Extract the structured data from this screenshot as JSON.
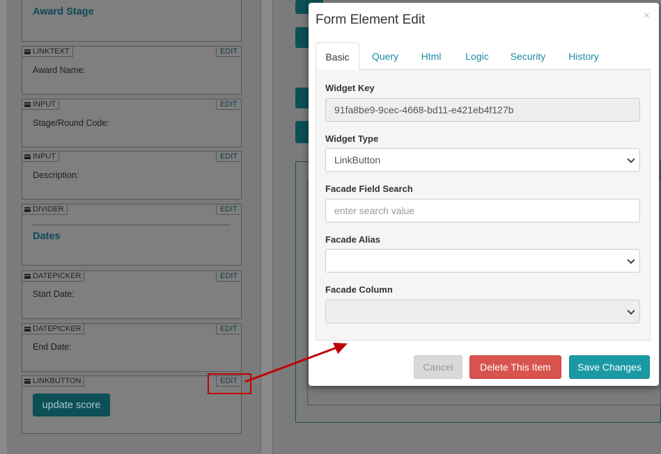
{
  "builder": {
    "widgets": [
      {
        "type": "",
        "edit": "",
        "heading": "Award Stage",
        "label": ""
      },
      {
        "type": "LINKTEXT",
        "edit": "EDIT",
        "label": "Award Name:"
      },
      {
        "type": "INPUT",
        "edit": "EDIT",
        "label": "Stage/Round Code:"
      },
      {
        "type": "INPUT",
        "edit": "EDIT",
        "label": "Description:"
      },
      {
        "type": "DIVIDER",
        "edit": "EDIT",
        "heading": "Dates"
      },
      {
        "type": "DATEPICKER",
        "edit": "EDIT",
        "label": "Start Date:"
      },
      {
        "type": "DATEPICKER",
        "edit": "EDIT",
        "label": "End Date:"
      },
      {
        "type": "LINKBUTTON",
        "edit": "EDIT",
        "button": "update score"
      }
    ]
  },
  "modal": {
    "title": "Form Element Edit",
    "close": "×",
    "tabs": [
      "Basic",
      "Query",
      "Html",
      "Logic",
      "Security",
      "History"
    ],
    "active_tab": "Basic",
    "fields": {
      "widget_key": {
        "label": "Widget Key",
        "value": "91fa8be9-9cec-4668-bd11-e421eb4f127b"
      },
      "widget_type": {
        "label": "Widget Type",
        "value": "LinkButton"
      },
      "facade_field_search": {
        "label": "Facade Field Search",
        "placeholder": "enter search value",
        "value": ""
      },
      "facade_alias": {
        "label": "Facade Alias",
        "value": ""
      },
      "facade_column": {
        "label": "Facade Column",
        "value": ""
      }
    },
    "buttons": {
      "cancel": "Cancel",
      "delete": "Delete This Item",
      "save": "Save Changes"
    }
  },
  "colors": {
    "annotation": "#c00000",
    "primary": "#1b9aa6",
    "danger": "#d9534f"
  }
}
